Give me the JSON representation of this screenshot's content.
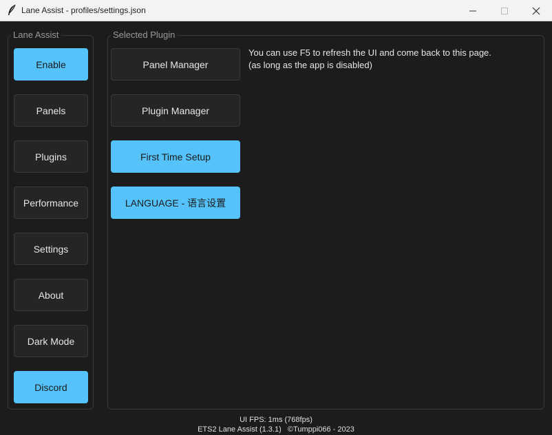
{
  "window": {
    "title": "Lane Assist - profiles/settings.json",
    "icon": "feather-icon"
  },
  "sidebar": {
    "label": "Lane Assist",
    "items": [
      {
        "label": "Enable",
        "active": true
      },
      {
        "label": "Panels",
        "active": false
      },
      {
        "label": "Plugins",
        "active": false
      },
      {
        "label": "Performance",
        "active": false
      },
      {
        "label": "Settings",
        "active": false
      },
      {
        "label": "About",
        "active": false
      },
      {
        "label": "Dark Mode",
        "active": false
      },
      {
        "label": "Discord",
        "active": true
      }
    ]
  },
  "main": {
    "label": "Selected Plugin",
    "buttons": [
      {
        "label": "Panel Manager",
        "active": false
      },
      {
        "label": "Plugin Manager",
        "active": false
      },
      {
        "label": "First Time Setup",
        "active": true
      },
      {
        "label": "LANGUAGE - 语言设置",
        "active": true
      }
    ],
    "info_line1": "You can use F5 to refresh the UI and come back to this page.",
    "info_line2": "(as long as the app is disabled)"
  },
  "footer": {
    "fps": "UI FPS: 1ms (768fps)",
    "credit": "ETS2 Lane Assist (1.3.1)   ©Tumppi066 - 2023"
  },
  "colors": {
    "accent": "#55c3fa",
    "background": "#1c1c1c",
    "button": "#252525"
  }
}
